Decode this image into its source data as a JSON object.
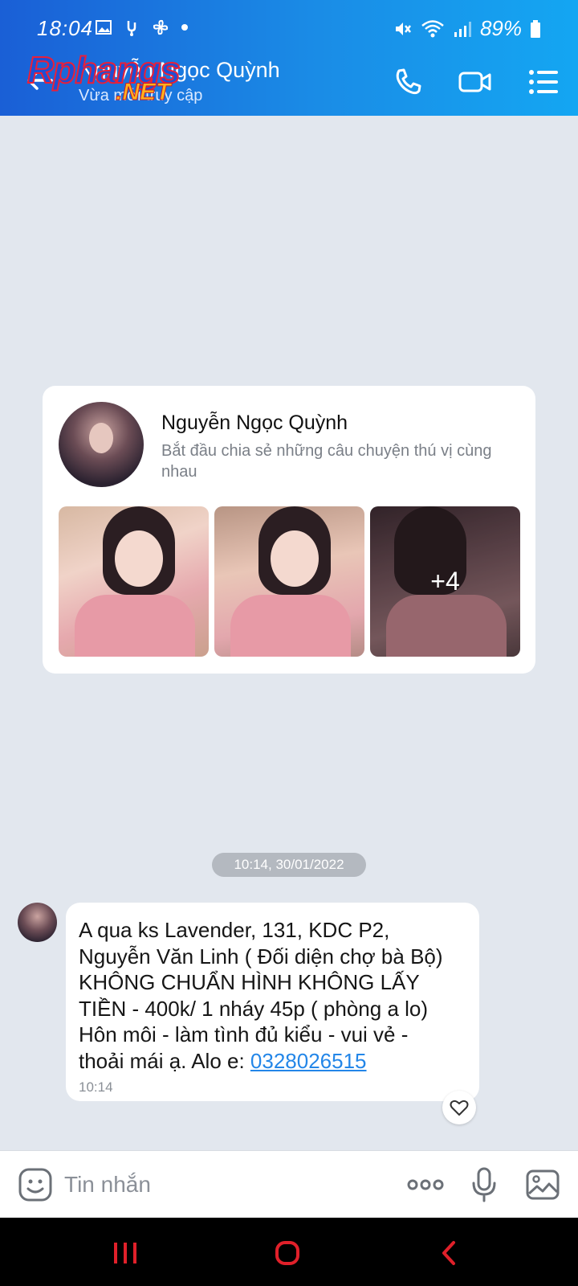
{
  "status_bar": {
    "time": "18:04",
    "battery": "89%",
    "icons": [
      "image-icon",
      "usb-icon",
      "pinwheel-icon",
      "dot-icon",
      "mute-icon",
      "wifi-icon",
      "signal-icon",
      "battery-icon"
    ]
  },
  "header": {
    "contact_name": "Nguyễn Ngọc Quỳnh",
    "status_text": "Vừa mới truy cập",
    "watermark_main": "Rphangs",
    "watermark_sub": ".NET",
    "icons": [
      "back-arrow-icon",
      "phone-icon",
      "video-call-icon",
      "menu-list-icon"
    ]
  },
  "profile_card": {
    "name": "Nguyễn Ngọc Quỳnh",
    "description": "Bắt đầu chia sẻ những câu chuyện thú vị cùng nhau",
    "more_count": "+4"
  },
  "timestamp_divider": "10:14, 30/01/2022",
  "message": {
    "lines": [
      "A qua ks Lavender, 131, KDC P2,",
      "Nguyễn Văn Linh ( Đối diện chợ bà Bộ)",
      "KHÔNG CHUẨN HÌNH KHÔNG LẤY",
      "TIỀN - 400k/ 1 nháy 45p ( phòng a lo)",
      "Hôn môi - làm tình đủ kiểu - vui vẻ -"
    ],
    "last_line_prefix": "thoải mái ạ. Alo e: ",
    "phone": "0328026515",
    "time": "10:14"
  },
  "input_bar": {
    "placeholder": "Tin nhắn"
  },
  "colors": {
    "header_start": "#1a5fd6",
    "header_end": "#14a6f2",
    "chat_background": "#e2e7ee",
    "link": "#2386e8",
    "nav_accent": "#e0202a"
  }
}
